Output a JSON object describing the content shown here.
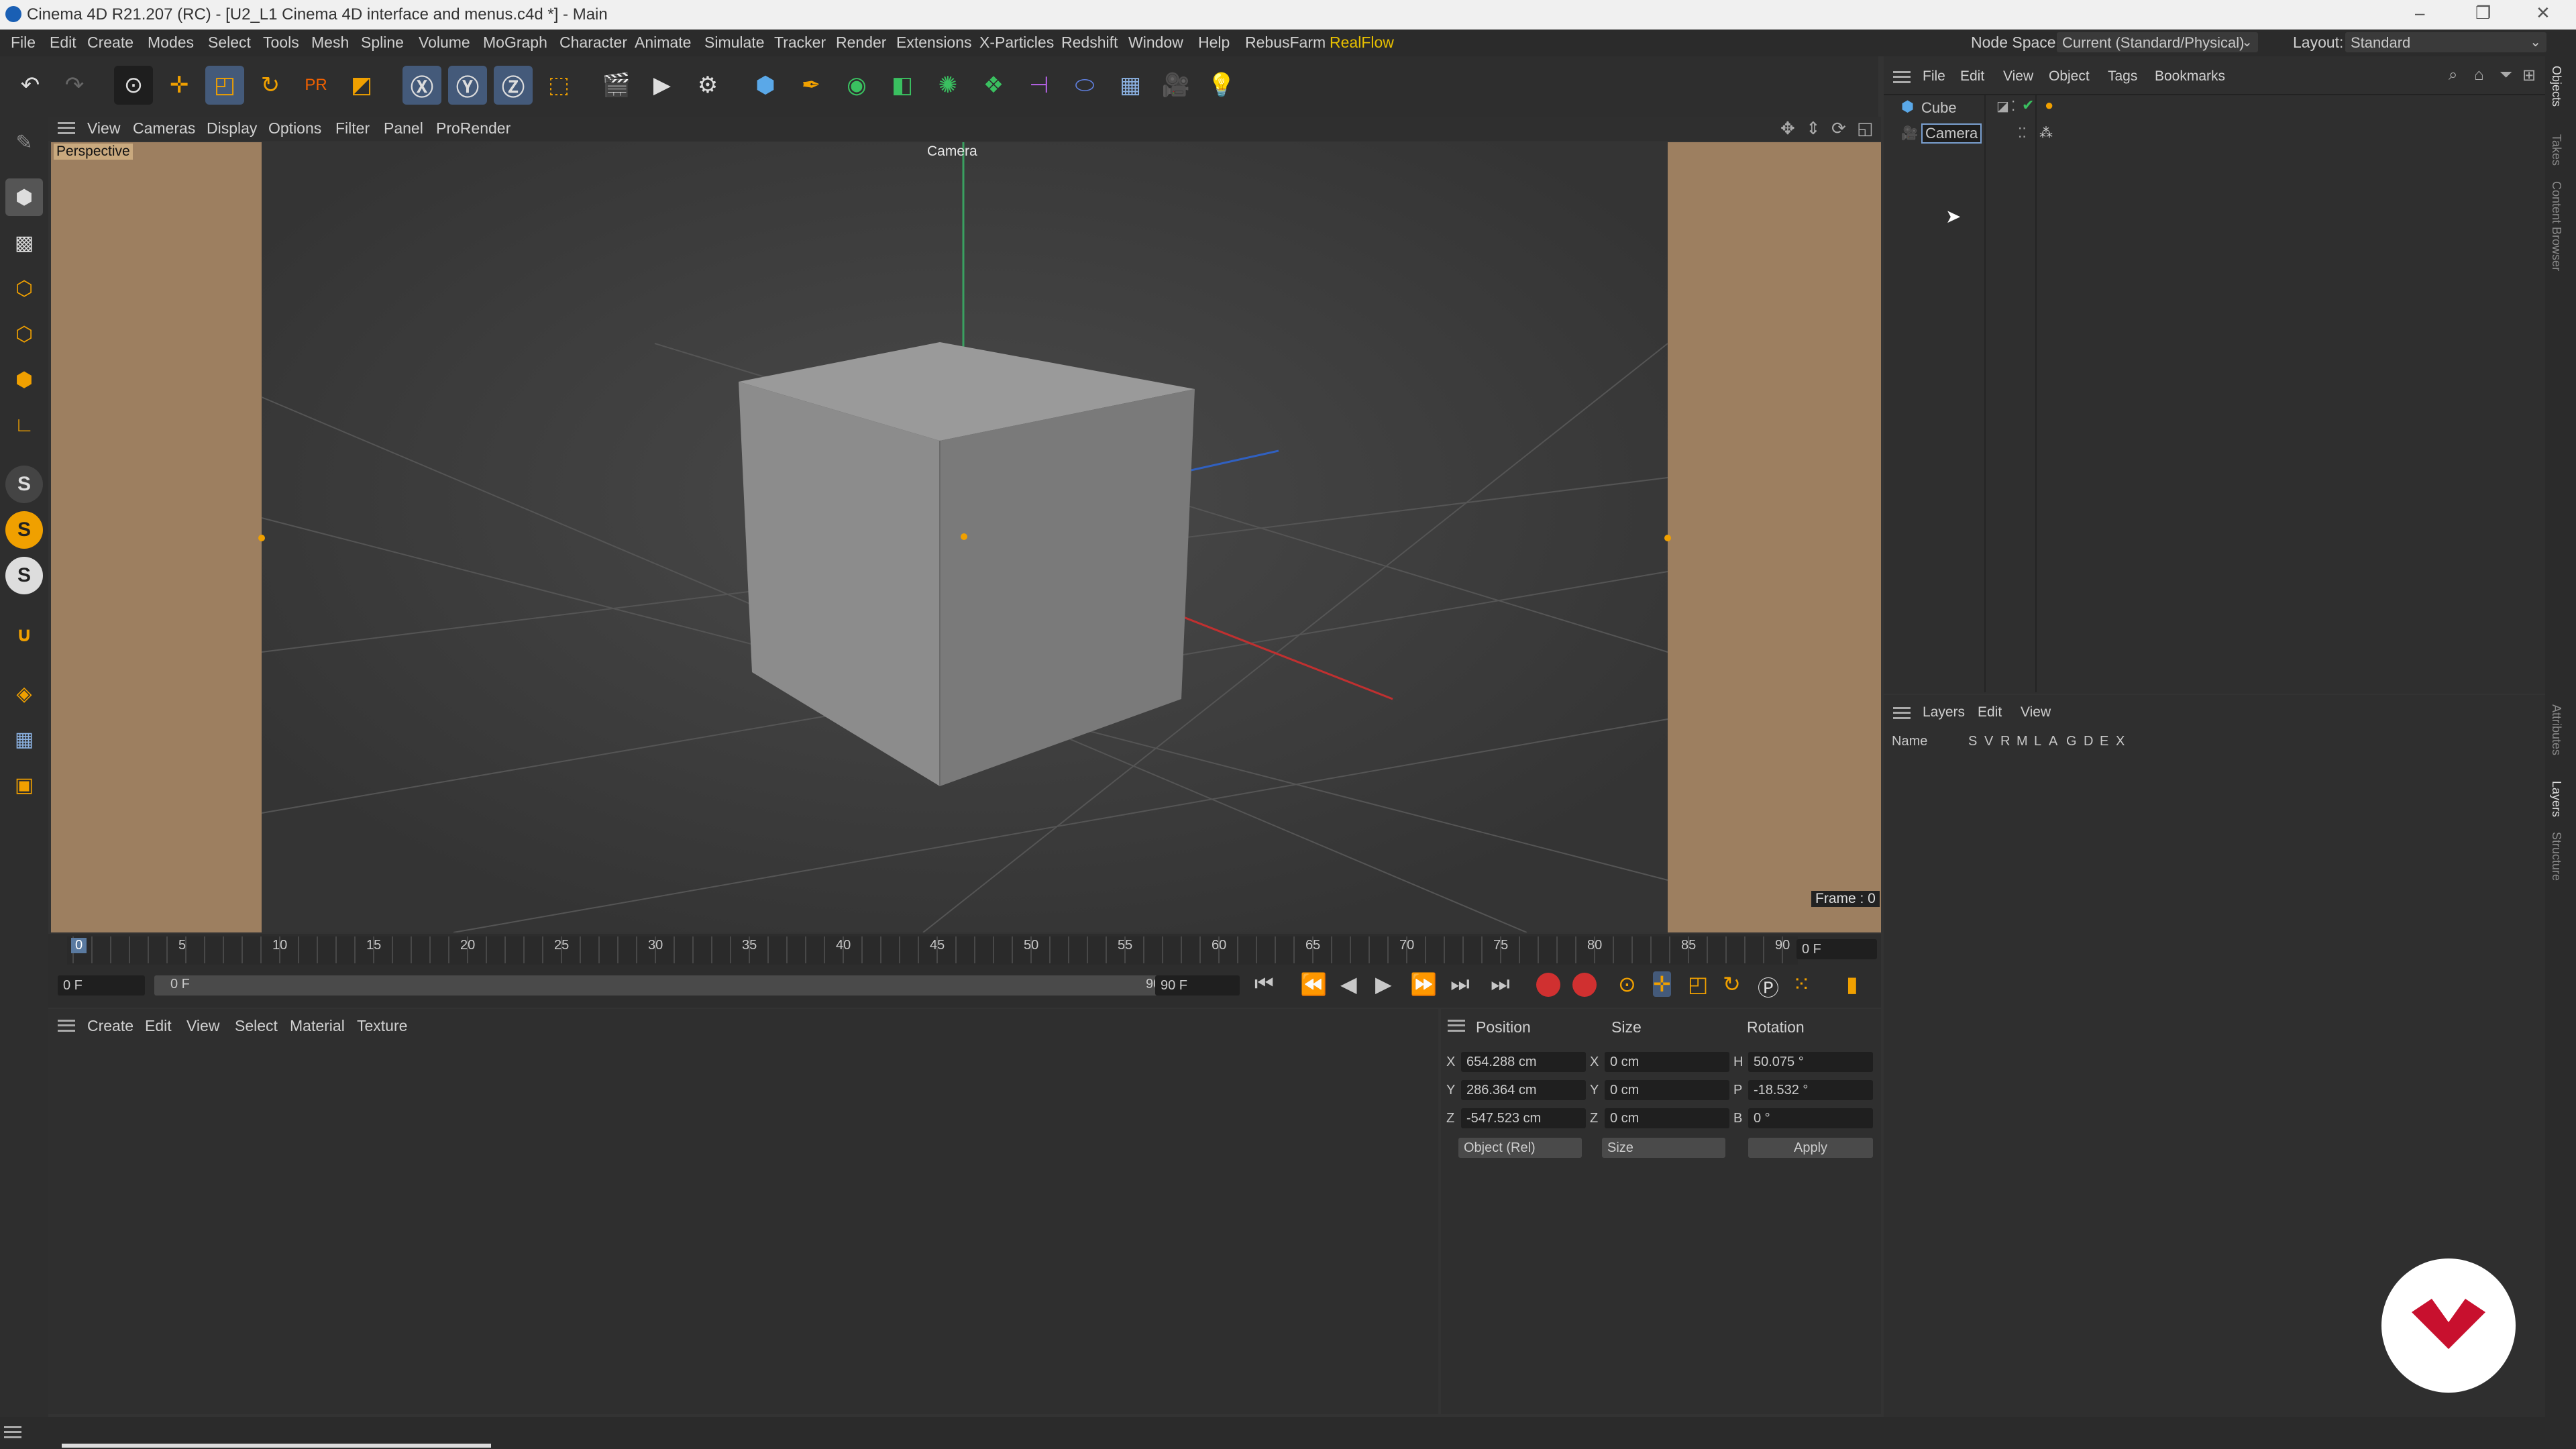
{
  "window": {
    "title": "Cinema 4D R21.207 (RC) - [U2_L1 Cinema 4D interface and menus.c4d *] - Main",
    "controls": [
      "–",
      "❐",
      "✕"
    ]
  },
  "menubar": {
    "items": [
      "File",
      "Edit",
      "Create",
      "Modes",
      "Select",
      "Tools",
      "Mesh",
      "Spline",
      "Volume",
      "MoGraph",
      "Character",
      "Animate",
      "Simulate",
      "Tracker",
      "Render",
      "Extensions",
      "X-Particles",
      "Redshift",
      "Window",
      "Help",
      "RebusFarm",
      "RealFlow"
    ],
    "highlight_color": "#e8c000",
    "node_space_label": "Node Space:",
    "node_space_value": "Current (Standard/Physical)",
    "layout_label": "Layout:",
    "layout_value": "Standard"
  },
  "viewport": {
    "menu": [
      "View",
      "Cameras",
      "Display",
      "Options",
      "Filter",
      "Panel",
      "ProRender"
    ],
    "label": "Perspective",
    "camera_label": "Camera",
    "frame_label": "Frame : 0"
  },
  "timeline": {
    "ticks": [
      "0",
      "5",
      "10",
      "15",
      "20",
      "25",
      "30",
      "35",
      "40",
      "45",
      "50",
      "55",
      "60",
      "65",
      "70",
      "75",
      "80",
      "85",
      "90"
    ],
    "current_frame": "0 F",
    "start_field": "0 F",
    "range_start": "0 F",
    "range_end": "90 F",
    "end_field": "90 F"
  },
  "material_manager": {
    "menu": [
      "Create",
      "Edit",
      "View",
      "Select",
      "Material",
      "Texture"
    ]
  },
  "coordinates": {
    "headers": [
      "Position",
      "Size",
      "Rotation"
    ],
    "rows": [
      {
        "axis": "X",
        "pos": "654.288 cm",
        "size_axis": "X",
        "size": "0 cm",
        "rot_axis": "H",
        "rot": "50.075 °"
      },
      {
        "axis": "Y",
        "pos": "286.364 cm",
        "size_axis": "Y",
        "size": "0 cm",
        "rot_axis": "P",
        "rot": "-18.532 °"
      },
      {
        "axis": "Z",
        "pos": "-547.523 cm",
        "size_axis": "Z",
        "size": "0 cm",
        "rot_axis": "B",
        "rot": "0 °"
      }
    ],
    "mode_select": "Object (Rel)",
    "size_select": "Size",
    "apply_label": "Apply"
  },
  "object_manager": {
    "menu": [
      "File",
      "Edit",
      "View",
      "Object",
      "Tags",
      "Bookmarks"
    ],
    "objects": [
      {
        "name": "Cube"
      },
      {
        "name": "Camera"
      }
    ]
  },
  "layers_manager": {
    "menu": [
      "Layers",
      "Edit",
      "View"
    ],
    "name_col": "Name",
    "flags": [
      "S",
      "V",
      "R",
      "M",
      "L",
      "A",
      "G",
      "D",
      "E",
      "X"
    ]
  },
  "right_tabs": [
    "Objects",
    "Takes",
    "Content Browser",
    "Attributes",
    "Layers",
    "Structure"
  ],
  "colors": {
    "accent_yellow": "#e8c000",
    "viewport_bg": "#3b3b3b",
    "safe_frame": "#9d7f60",
    "logo_red": "#c8102e"
  }
}
